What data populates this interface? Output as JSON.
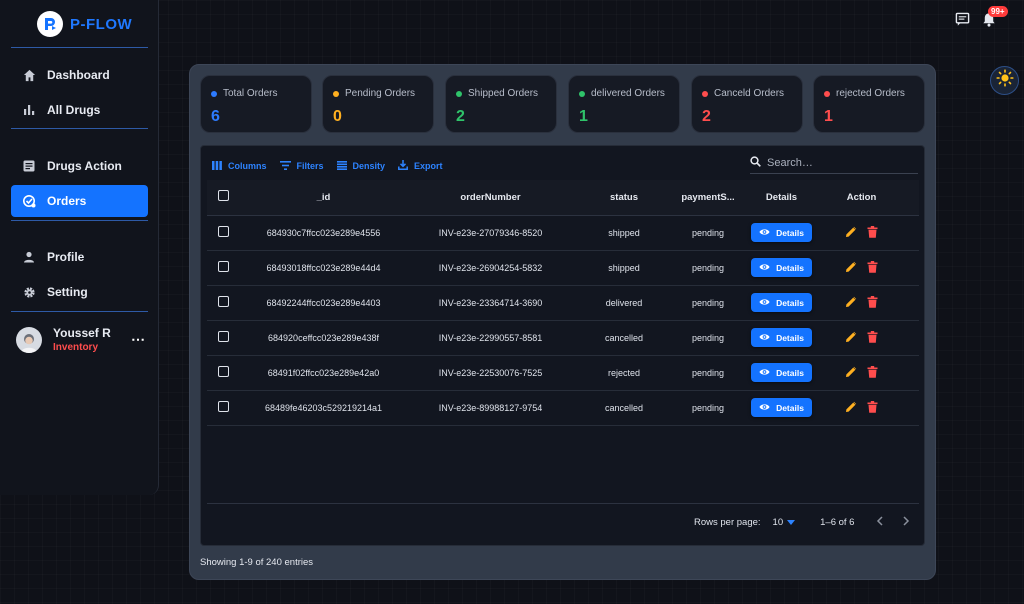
{
  "app": {
    "name": "P-FLOW"
  },
  "sidebar": {
    "items": [
      {
        "label": "Dashboard",
        "icon": "home-icon"
      },
      {
        "label": "All Drugs",
        "icon": "bar-chart-icon"
      },
      {
        "label": "Drugs Action",
        "icon": "list-icon"
      },
      {
        "label": "Orders",
        "icon": "order-icon",
        "active": true
      },
      {
        "label": "Profile",
        "icon": "person-icon"
      },
      {
        "label": "Setting",
        "icon": "gear-icon"
      }
    ],
    "user": {
      "name": "Youssef R",
      "role": "Inventory"
    }
  },
  "header": {
    "notification_count": "99+"
  },
  "stats": [
    {
      "label": "Total Orders",
      "value": "6",
      "color": "#2d7bff"
    },
    {
      "label": "Pending Orders",
      "value": "0",
      "color": "#ffb020"
    },
    {
      "label": "Shipped Orders",
      "value": "2",
      "color": "#2fc36a"
    },
    {
      "label": "delivered Orders",
      "value": "1",
      "color": "#2fc36a"
    },
    {
      "label": "Canceld Orders",
      "value": "2",
      "color": "#ff4d4d"
    },
    {
      "label": "rejected Orders",
      "value": "1",
      "color": "#ff4d4d"
    }
  ],
  "toolbar": {
    "columns": "Columns",
    "filters": "Filters",
    "density": "Density",
    "export": "Export"
  },
  "search": {
    "placeholder": "Search…"
  },
  "table": {
    "headers": {
      "id": "_id",
      "order_number": "orderNumber",
      "status": "status",
      "payment": "paymentS...",
      "details": "Details",
      "action": "Action"
    },
    "details_label": "Details",
    "rows": [
      {
        "id": "684930c7ffcc023e289e4556",
        "order_number": "INV-e23e-27079346-8520",
        "status": "shipped",
        "payment": "pending"
      },
      {
        "id": "68493018ffcc023e289e44d4",
        "order_number": "INV-e23e-26904254-5832",
        "status": "shipped",
        "payment": "pending"
      },
      {
        "id": "68492244ffcc023e289e4403",
        "order_number": "INV-e23e-23364714-3690",
        "status": "delivered",
        "payment": "pending"
      },
      {
        "id": "684920ceffcc023e289e438f",
        "order_number": "INV-e23e-22990557-8581",
        "status": "cancelled",
        "payment": "pending"
      },
      {
        "id": "68491f02ffcc023e289e42a0",
        "order_number": "INV-e23e-22530076-7525",
        "status": "rejected",
        "payment": "pending"
      },
      {
        "id": "68489fe46203c529219214a1",
        "order_number": "INV-e23e-89988127-9754",
        "status": "cancelled",
        "payment": "pending"
      }
    ]
  },
  "pagination": {
    "rows_label": "Rows per page:",
    "rows_value": "10",
    "range": "1–6 of 6"
  },
  "entries_text": "Showing 1-9 of 240 entries"
}
